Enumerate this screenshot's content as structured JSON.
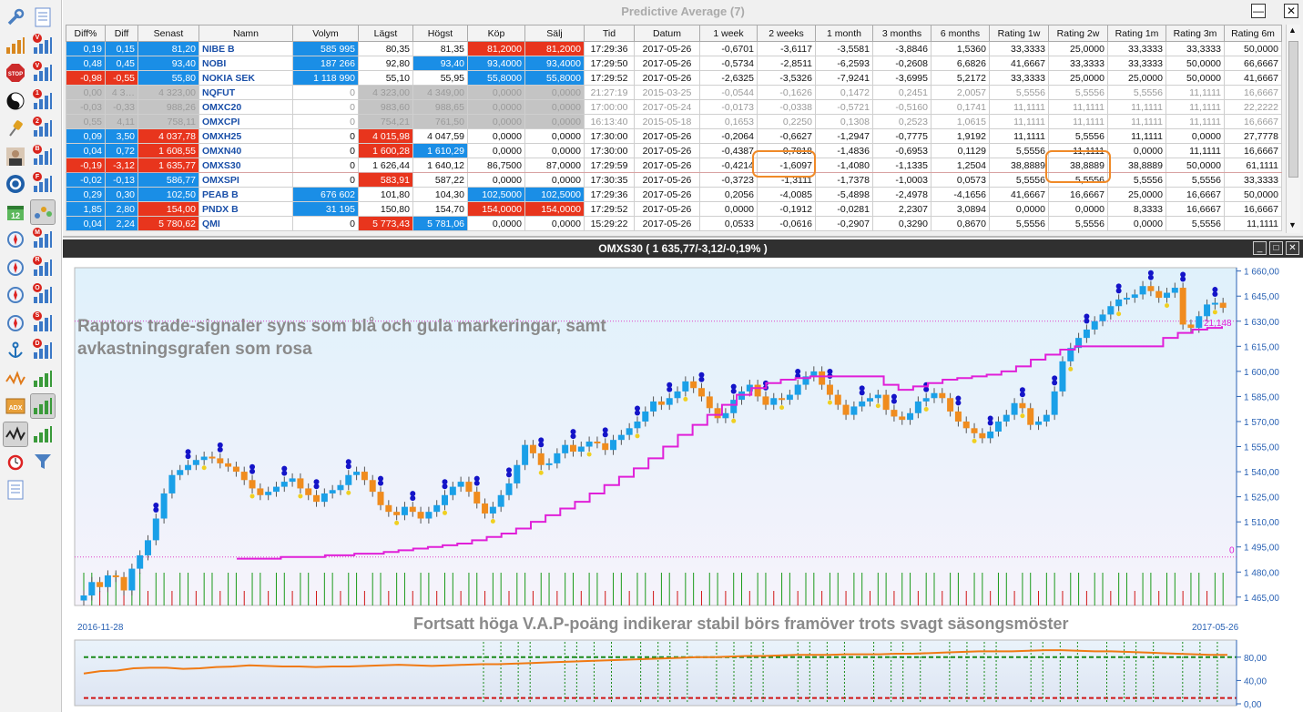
{
  "toolbar": {
    "items": [
      {
        "icon": "wrench-icon"
      },
      {
        "icon": "document-list-icon"
      },
      {
        "icon": "bar-chart-icon"
      },
      {
        "icon": "chart-v-icon",
        "badge": "V"
      },
      {
        "icon": "stop-sign-icon",
        "label": "STOP"
      },
      {
        "icon": "chart-v-icon",
        "badge": "V"
      },
      {
        "icon": "yin-yang-icon"
      },
      {
        "icon": "chart-1-icon",
        "badge": "1"
      },
      {
        "icon": "pin-icon"
      },
      {
        "icon": "chart-2-icon",
        "badge": "2"
      },
      {
        "icon": "user-photo-icon"
      },
      {
        "icon": "chart-b-icon",
        "badge": "B"
      },
      {
        "icon": "swirl-logo-icon"
      },
      {
        "icon": "chart-f-icon",
        "badge": "F"
      },
      {
        "icon": "calendar-icon",
        "label": "12"
      },
      {
        "icon": "scatter-icon"
      },
      {
        "icon": "compass-icon"
      },
      {
        "icon": "chart-m-icon",
        "badge": "M"
      },
      {
        "icon": "compass-icon"
      },
      {
        "icon": "chart-r-icon",
        "badge": "R"
      },
      {
        "icon": "compass-icon"
      },
      {
        "icon": "chart-o-icon",
        "badge": "O"
      },
      {
        "icon": "compass-icon"
      },
      {
        "icon": "chart-s-icon",
        "badge": "S"
      },
      {
        "icon": "anchor-icon"
      },
      {
        "icon": "chart-d-icon",
        "badge": "D"
      },
      {
        "icon": "line-chart-icon"
      },
      {
        "icon": "bar-chart-icon"
      },
      {
        "icon": "adx-icon",
        "label": "ADX"
      },
      {
        "icon": "bar-chart-icon"
      },
      {
        "icon": "waveform-icon"
      },
      {
        "icon": "bar-chart-icon"
      },
      {
        "icon": "alarm-clock-icon"
      },
      {
        "icon": "funnel-icon"
      },
      {
        "icon": "blank-document-icon"
      }
    ]
  },
  "table_window": {
    "title": "Predictive Average (7)",
    "columns": [
      "Diff%",
      "Diff",
      "Senast",
      "Namn",
      "Volym",
      "Lägst",
      "Högst",
      "Köp",
      "Sälj",
      "Tid",
      "Datum",
      "1 week",
      "2 weeks",
      "1 month",
      "3 months",
      "6 months",
      "Rating 1w",
      "Rating 2w",
      "Rating 1m",
      "Rating 3m",
      "Rating 6m"
    ],
    "rows": [
      {
        "cells": [
          "0,19",
          "0,15",
          "81,20",
          "NIBE B",
          "585 995",
          "80,35",
          "81,35",
          "81,2000",
          "81,2000",
          "17:29:36",
          "2017-05-26",
          "-0,6701",
          "-3,6117",
          "-3,5581",
          "-3,8846",
          "1,5360",
          "33,3333",
          "25,0000",
          "33,3333",
          "33,3333",
          "50,0000"
        ],
        "colors": [
          "blue",
          "blue",
          "blue",
          "",
          "blue",
          "",
          "",
          "red",
          "red",
          "",
          "",
          "",
          "",
          "",
          "",
          "",
          "",
          "",
          "",
          "",
          ""
        ]
      },
      {
        "cells": [
          "0,48",
          "0,45",
          "93,40",
          "NOBI",
          "187 266",
          "92,80",
          "93,40",
          "93,4000",
          "93,4000",
          "17:29:50",
          "2017-05-26",
          "-0,5734",
          "-2,8511",
          "-6,2593",
          "-0,2608",
          "6,6826",
          "41,6667",
          "33,3333",
          "33,3333",
          "50,0000",
          "66,6667"
        ],
        "colors": [
          "blue",
          "blue",
          "blue",
          "",
          "blue",
          "",
          "blue",
          "blue",
          "blue",
          "",
          "",
          "",
          "",
          "",
          "",
          "",
          "",
          "",
          "",
          "",
          ""
        ]
      },
      {
        "cells": [
          "-0,98",
          "-0,55",
          "55,80",
          "NOKIA SEK",
          "1 118 990",
          "55,10",
          "55,95",
          "55,8000",
          "55,8000",
          "17:29:52",
          "2017-05-26",
          "-2,6325",
          "-3,5326",
          "-7,9241",
          "-3,6995",
          "5,2172",
          "33,3333",
          "25,0000",
          "25,0000",
          "50,0000",
          "41,6667"
        ],
        "colors": [
          "red",
          "red",
          "blue",
          "",
          "blue",
          "",
          "",
          "blue",
          "blue",
          "",
          "",
          "",
          "",
          "",
          "",
          "",
          "",
          "",
          "",
          "",
          ""
        ]
      },
      {
        "cells": [
          "0,00",
          "4 3…",
          "4 323,00",
          "NQFUT",
          "0",
          "4 323,00",
          "4 349,00",
          "0,0000",
          "0,0000",
          "21:27:19",
          "2015-03-25",
          "-0,0544",
          "-0,1626",
          "0,1472",
          "0,2451",
          "2,0057",
          "5,5556",
          "5,5556",
          "5,5556",
          "11,1111",
          "16,6667"
        ],
        "colors": [
          "gray",
          "gray",
          "gray",
          "",
          "",
          "gray",
          "gray",
          "gray",
          "gray",
          "",
          "",
          "",
          "",
          "",
          "",
          "",
          "",
          "",
          "",
          "",
          ""
        ],
        "dim": true
      },
      {
        "cells": [
          "-0,03",
          "-0,33",
          "988,26",
          "OMXC20",
          "0",
          "983,60",
          "988,65",
          "0,0000",
          "0,0000",
          "17:00:00",
          "2017-05-24",
          "-0,0173",
          "-0,0338",
          "-0,5721",
          "-0,5160",
          "0,1741",
          "11,1111",
          "11,1111",
          "11,1111",
          "11,1111",
          "22,2222"
        ],
        "colors": [
          "gray",
          "gray",
          "gray",
          "",
          "",
          "gray",
          "gray",
          "gray",
          "gray",
          "",
          "",
          "",
          "",
          "",
          "",
          "",
          "",
          "",
          "",
          "",
          ""
        ],
        "dim": true
      },
      {
        "cells": [
          "0,55",
          "4,11",
          "758,11",
          "OMXCPI",
          "0",
          "754,21",
          "761,50",
          "0,0000",
          "0,0000",
          "16:13:40",
          "2015-05-18",
          "0,1653",
          "0,2250",
          "0,1308",
          "0,2523",
          "1,0615",
          "11,1111",
          "11,1111",
          "11,1111",
          "11,1111",
          "16,6667"
        ],
        "colors": [
          "gray",
          "gray",
          "gray",
          "",
          "",
          "gray",
          "gray",
          "gray",
          "gray",
          "",
          "",
          "",
          "",
          "",
          "",
          "",
          "",
          "",
          "",
          "",
          ""
        ],
        "dim": true
      },
      {
        "cells": [
          "0,09",
          "3,50",
          "4 037,78",
          "OMXH25",
          "0",
          "4 015,98",
          "4 047,59",
          "0,0000",
          "0,0000",
          "17:30:00",
          "2017-05-26",
          "-0,2064",
          "-0,6627",
          "-1,2947",
          "-0,7775",
          "1,9192",
          "11,1111",
          "5,5556",
          "11,1111",
          "0,0000",
          "27,7778"
        ],
        "colors": [
          "blue",
          "blue",
          "red",
          "",
          "",
          "red",
          "",
          "",
          "",
          "",
          "",
          "",
          "",
          "",
          "",
          "",
          "",
          "",
          "",
          "",
          ""
        ]
      },
      {
        "cells": [
          "0,04",
          "0,72",
          "1 608,55",
          "OMXN40",
          "0",
          "1 600,28",
          "1 610,29",
          "0,0000",
          "0,0000",
          "17:30:00",
          "2017-05-26",
          "-0,4387",
          "-0,7818",
          "-1,4836",
          "-0,6953",
          "0,1129",
          "5,5556",
          "11,1111",
          "0,0000",
          "11,1111",
          "16,6667"
        ],
        "colors": [
          "blue",
          "blue",
          "red",
          "",
          "",
          "red",
          "blue",
          "",
          "",
          "",
          "",
          "",
          "",
          "",
          "",
          "",
          "",
          "",
          "",
          "",
          ""
        ]
      },
      {
        "cells": [
          "-0,19",
          "-3,12",
          "1 635,77",
          "OMXS30",
          "0",
          "1 626,44",
          "1 640,12",
          "86,7500",
          "87,0000",
          "17:29:59",
          "2017-05-26",
          "-0,4214",
          "-1,6097",
          "-1,4080",
          "-1,1335",
          "1,2504",
          "38,8889",
          "38,8889",
          "38,8889",
          "50,0000",
          "61,1111"
        ],
        "colors": [
          "red",
          "red",
          "red",
          "",
          "",
          "",
          "",
          "",
          "",
          "",
          "",
          "",
          "",
          "",
          "",
          "",
          "",
          "",
          "",
          "",
          ""
        ],
        "highlight": true
      },
      {
        "cells": [
          "-0,02",
          "-0,13",
          "586,77",
          "OMXSPI",
          "0",
          "583,91",
          "587,22",
          "0,0000",
          "0,0000",
          "17:30:35",
          "2017-05-26",
          "-0,3723",
          "-1,3111",
          "-1,7378",
          "-1,0003",
          "0,0573",
          "5,5556",
          "5,5556",
          "5,5556",
          "5,5556",
          "33,3333"
        ],
        "colors": [
          "blue",
          "blue",
          "blue",
          "",
          "",
          "red",
          "",
          "",
          "",
          "",
          "",
          "",
          "",
          "",
          "",
          "",
          "",
          "",
          "",
          "",
          ""
        ]
      },
      {
        "cells": [
          "0,29",
          "0,30",
          "102,50",
          "PEAB B",
          "676 602",
          "101,80",
          "104,30",
          "102,5000",
          "102,5000",
          "17:29:36",
          "2017-05-26",
          "0,2056",
          "-4,0085",
          "-5,4898",
          "-2,4978",
          "-4,1656",
          "41,6667",
          "16,6667",
          "25,0000",
          "16,6667",
          "50,0000"
        ],
        "colors": [
          "blue",
          "blue",
          "blue",
          "",
          "blue",
          "",
          "",
          "blue",
          "blue",
          "",
          "",
          "",
          "",
          "",
          "",
          "",
          "",
          "",
          "",
          "",
          ""
        ]
      },
      {
        "cells": [
          "1,85",
          "2,80",
          "154,00",
          "PNDX B",
          "31 195",
          "150,80",
          "154,70",
          "154,0000",
          "154,0000",
          "17:29:52",
          "2017-05-26",
          "0,0000",
          "-0,1912",
          "-0,0281",
          "2,2307",
          "3,0894",
          "0,0000",
          "0,0000",
          "8,3333",
          "16,6667",
          "16,6667"
        ],
        "colors": [
          "blue",
          "blue",
          "red",
          "",
          "blue",
          "",
          "",
          "red",
          "red",
          "",
          "",
          "",
          "",
          "",
          "",
          "",
          "",
          "",
          "",
          "",
          ""
        ]
      },
      {
        "cells": [
          "0,04",
          "2,24",
          "5 780,62",
          "QMI",
          "0",
          "5 773,43",
          "5 781,06",
          "0,0000",
          "0,0000",
          "15:29:22",
          "2017-05-26",
          "0,0533",
          "-0,0616",
          "-0,2907",
          "0,3290",
          "0,8670",
          "5,5556",
          "5,5556",
          "0,0000",
          "5,5556",
          "11,1111"
        ],
        "colors": [
          "blue",
          "blue",
          "red",
          "",
          "",
          "red",
          "blue",
          "",
          "",
          "",
          "",
          "",
          "",
          "",
          "",
          "",
          "",
          "",
          "",
          "",
          ""
        ]
      }
    ]
  },
  "chart_window": {
    "title": "OMXS30 ( 1 635,77/-3,12/-0,19% )",
    "annotation_main": "Raptors trade-signaler syns som blå och gula markeringar, samt avkastningsgrafen som rosa",
    "annotation_bottom": "Fortsatt höga V.A.P-poäng indikerar stabil börs framöver trots svagt säsongsmöster",
    "date_start": "2016-11-28",
    "date_end": "2017-05-26",
    "price_marker": "21,148",
    "zero_marker": "0"
  },
  "chart_data": [
    {
      "type": "candlestick",
      "title": "OMXS30 ( 1 635,77/-3,12/-0,19% )",
      "xlabel": "",
      "ylabel": "",
      "x_range": [
        "2016-11-28",
        "2017-05-26"
      ],
      "ylim": [
        1460,
        1662
      ],
      "yticks": [
        "1 660,00",
        "1 645,00",
        "1 630,00",
        "1 615,00",
        "1 600,00",
        "1 585,00",
        "1 570,00",
        "1 555,00",
        "1 540,00",
        "1 525,00",
        "1 510,00",
        "1 495,00",
        "1 480,00",
        "1 465,00"
      ],
      "close": [
        1466,
        1474,
        1471,
        1478,
        1477,
        1469,
        1482,
        1490,
        1499,
        1512,
        1527,
        1538,
        1541,
        1544,
        1547,
        1549,
        1548,
        1545,
        1543,
        1540,
        1535,
        1530,
        1526,
        1528,
        1531,
        1534,
        1536,
        1530,
        1526,
        1522,
        1527,
        1529,
        1532,
        1538,
        1540,
        1535,
        1528,
        1520,
        1516,
        1514,
        1519,
        1516,
        1512,
        1516,
        1520,
        1526,
        1531,
        1534,
        1528,
        1521,
        1515,
        1519,
        1526,
        1533,
        1544,
        1556,
        1551,
        1544,
        1545,
        1551,
        1556,
        1552,
        1555,
        1558,
        1557,
        1553,
        1559,
        1562,
        1566,
        1570,
        1576,
        1582,
        1580,
        1584,
        1588,
        1594,
        1590,
        1585,
        1578,
        1572,
        1575,
        1583,
        1588,
        1592,
        1585,
        1580,
        1584,
        1583,
        1586,
        1592,
        1597,
        1600,
        1592,
        1586,
        1580,
        1574,
        1579,
        1582,
        1584,
        1586,
        1577,
        1573,
        1571,
        1575,
        1582,
        1584,
        1587,
        1584,
        1576,
        1570,
        1566,
        1563,
        1560,
        1564,
        1570,
        1574,
        1581,
        1578,
        1568,
        1570,
        1574,
        1588,
        1606,
        1614,
        1620,
        1625,
        1630,
        1634,
        1639,
        1643,
        1644,
        1646,
        1651,
        1648,
        1644,
        1647,
        1650,
        1628,
        1626,
        1633,
        1640,
        1641,
        1638
      ],
      "series": [
        {
          "name": "",
          "values": [
            1488,
            1488,
            1488,
            1489,
            1489,
            1489,
            1490,
            1490,
            1491,
            1491,
            1492,
            1493,
            1494,
            1495,
            1496,
            1497,
            1499,
            1501,
            1503,
            1506,
            1510,
            1514,
            1518,
            1522,
            1527,
            1532,
            1537,
            1542,
            1548,
            1555,
            1562,
            1568,
            1574,
            1580,
            1586,
            1590,
            1593,
            1595,
            1596,
            1597,
            1597,
            1597,
            1597,
            1597,
            1592,
            1589,
            1591,
            1593,
            1595,
            1596,
            1597,
            1598,
            1600,
            1603,
            1607,
            1610,
            1613,
            1615,
            1615,
            1615,
            1615,
            1615,
            1615,
            1620,
            1623,
            1625,
            1626,
            1627
          ]
        }
      ]
    },
    {
      "type": "line",
      "title": "",
      "ylim": [
        0,
        100
      ],
      "yticks": [
        "80,00",
        "40,00",
        "0,00"
      ],
      "reference_lines": [
        80,
        10
      ],
      "series": [
        {
          "name": "",
          "values": [
            52,
            56,
            57,
            61,
            62,
            62,
            60,
            61,
            63,
            64,
            66,
            65,
            64,
            64,
            63,
            64,
            64,
            65,
            66,
            67,
            66,
            65,
            66,
            67,
            68,
            68,
            69,
            70,
            71,
            72,
            73,
            74,
            75,
            76,
            77,
            78,
            79,
            80,
            80,
            81,
            82,
            82,
            83,
            84,
            84,
            84,
            85,
            85,
            85,
            86,
            86,
            87,
            88,
            89,
            90,
            90,
            90,
            91,
            92,
            92,
            91,
            90,
            90,
            89,
            88,
            87,
            86,
            85,
            84,
            84
          ]
        }
      ]
    }
  ]
}
